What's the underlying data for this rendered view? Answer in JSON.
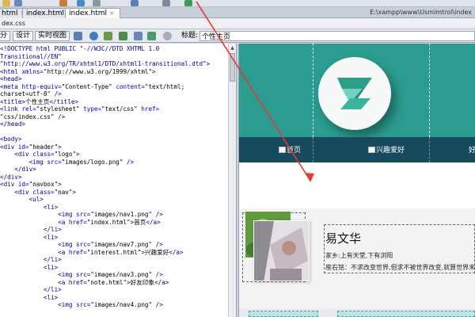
{
  "tabs": [
    {
      "label": "html",
      "active": false
    },
    {
      "label": "index.html",
      "active": false
    },
    {
      "label": "index.html",
      "active": true
    }
  ],
  "tab_close_glyph": "×",
  "file_path": "E:\\xampp\\www\\Usmimtrol\\index",
  "related_files": "dex.css",
  "view_buttons": {
    "split": "分",
    "design": "设计",
    "live_view": "实时视图"
  },
  "title_field": {
    "label": "标题:",
    "value": "个性主页"
  },
  "code_lines": [
    [
      [
        "t",
        "<!DOCTYPE html PUBLIC \"-//W3C//DTD XHTML 1.0"
      ]
    ],
    [
      [
        "t",
        "Transitional//EN\""
      ]
    ],
    [
      [
        "t",
        "\"http://www.w3.org/TR/xhtml1/DTD/xhtml1-transitional.dtd\">"
      ]
    ],
    [
      [
        "t",
        "<html "
      ],
      [
        "a",
        "xmlns="
      ],
      [
        "s",
        "\"http://www.w3.org/1999/xhtml\""
      ],
      [
        "t",
        ">"
      ]
    ],
    [
      [
        "t",
        "<head>"
      ]
    ],
    [
      [
        "t",
        "<meta "
      ],
      [
        "a",
        "http-equiv="
      ],
      [
        "s",
        "\"Content-Type\" "
      ],
      [
        "a",
        "content="
      ],
      [
        "s",
        "\"text/html;"
      ]
    ],
    [
      [
        "s",
        "charset=utf-8\""
      ],
      [
        "t",
        " />"
      ]
    ],
    [
      [
        "t",
        "<title>"
      ],
      [
        "x",
        "个性主页"
      ],
      [
        "t",
        "</title>"
      ]
    ],
    [
      [
        "t",
        "<link "
      ],
      [
        "a",
        "rel="
      ],
      [
        "s",
        "\"stylesheet\" "
      ],
      [
        "a",
        "type="
      ],
      [
        "s",
        "\"text/css\" "
      ],
      [
        "a",
        "href="
      ]
    ],
    [
      [
        "s",
        "\"css/index.css\""
      ],
      [
        "t",
        " />"
      ]
    ],
    [
      [
        "t",
        "</head>"
      ]
    ],
    [
      [
        "x",
        ""
      ]
    ],
    [
      [
        "t",
        "<body>"
      ]
    ],
    [
      [
        "t",
        "<div "
      ],
      [
        "a",
        "id="
      ],
      [
        "s",
        "\"header\""
      ],
      [
        "t",
        ">"
      ]
    ],
    [
      [
        "x",
        "    "
      ],
      [
        "t",
        "<div "
      ],
      [
        "a",
        "class="
      ],
      [
        "s",
        "\"logo\""
      ],
      [
        "t",
        ">"
      ]
    ],
    [
      [
        "x",
        "        "
      ],
      [
        "t",
        "<img "
      ],
      [
        "a",
        "src="
      ],
      [
        "s",
        "\"images/logo.png\""
      ],
      [
        "t",
        " />"
      ]
    ],
    [
      [
        "x",
        "    "
      ],
      [
        "t",
        "</div>"
      ]
    ],
    [
      [
        "t",
        "</div>"
      ]
    ],
    [
      [
        "t",
        "<div "
      ],
      [
        "a",
        "id="
      ],
      [
        "s",
        "\"navbox\""
      ],
      [
        "t",
        ">"
      ]
    ],
    [
      [
        "x",
        "    "
      ],
      [
        "t",
        "<div "
      ],
      [
        "a",
        "class="
      ],
      [
        "s",
        "\"nav\""
      ],
      [
        "t",
        ">"
      ]
    ],
    [
      [
        "x",
        "        "
      ],
      [
        "t",
        "<ul>"
      ]
    ],
    [
      [
        "x",
        "            "
      ],
      [
        "t",
        "<li>"
      ]
    ],
    [
      [
        "x",
        "                "
      ],
      [
        "t",
        "<img "
      ],
      [
        "a",
        "src="
      ],
      [
        "s",
        "\"images/nav1.png\""
      ],
      [
        "t",
        " />"
      ]
    ],
    [
      [
        "x",
        "                "
      ],
      [
        "t",
        "<a "
      ],
      [
        "a",
        "href="
      ],
      [
        "s",
        "\"index.html\""
      ],
      [
        "t",
        ">"
      ],
      [
        "x",
        "首页"
      ],
      [
        "t",
        "</a>"
      ]
    ],
    [
      [
        "x",
        "            "
      ],
      [
        "t",
        "</li>"
      ]
    ],
    [
      [
        "x",
        "            "
      ],
      [
        "t",
        "<li>"
      ]
    ],
    [
      [
        "x",
        "                "
      ],
      [
        "t",
        "<img "
      ],
      [
        "a",
        "src="
      ],
      [
        "s",
        "\"images/nav7.png\""
      ],
      [
        "t",
        " />"
      ]
    ],
    [
      [
        "x",
        "                "
      ],
      [
        "t",
        "<a "
      ],
      [
        "a",
        "href="
      ],
      [
        "s",
        "\"interest.html\""
      ],
      [
        "t",
        ">"
      ],
      [
        "x",
        "兴趣爱好"
      ],
      [
        "t",
        "</a>"
      ]
    ],
    [
      [
        "x",
        "            "
      ],
      [
        "t",
        "</li>"
      ]
    ],
    [
      [
        "x",
        "            "
      ],
      [
        "t",
        "<li>"
      ]
    ],
    [
      [
        "x",
        "                "
      ],
      [
        "t",
        "<img "
      ],
      [
        "a",
        "src="
      ],
      [
        "s",
        "\"images/nav3.png\""
      ],
      [
        "t",
        " />"
      ]
    ],
    [
      [
        "x",
        "                "
      ],
      [
        "t",
        "<a "
      ],
      [
        "a",
        "href="
      ],
      [
        "s",
        "\"note.html\""
      ],
      [
        "t",
        ">"
      ],
      [
        "x",
        "好友印象"
      ],
      [
        "t",
        "</a>"
      ]
    ],
    [
      [
        "x",
        "            "
      ],
      [
        "t",
        "</li>"
      ]
    ],
    [
      [
        "x",
        "            "
      ],
      [
        "t",
        "<li>"
      ]
    ],
    [
      [
        "x",
        "                "
      ],
      [
        "t",
        "<img "
      ],
      [
        "a",
        "src="
      ],
      [
        "s",
        "\"images/nav4.png\""
      ],
      [
        "t",
        " />"
      ]
    ]
  ],
  "nav": {
    "items": [
      "首页",
      "兴趣爱好",
      "好"
    ]
  },
  "profile": {
    "name": "易文华",
    "hometown": "家乡:上有天堂,下有浏阳",
    "motto": "座右铭：不求改变世界,但求不被世界改变,就算世界末日"
  },
  "colors": {
    "header_bg": "#2b9c8f",
    "nav_bg": "#164a5c",
    "annotation_arrow": "#e53935"
  }
}
